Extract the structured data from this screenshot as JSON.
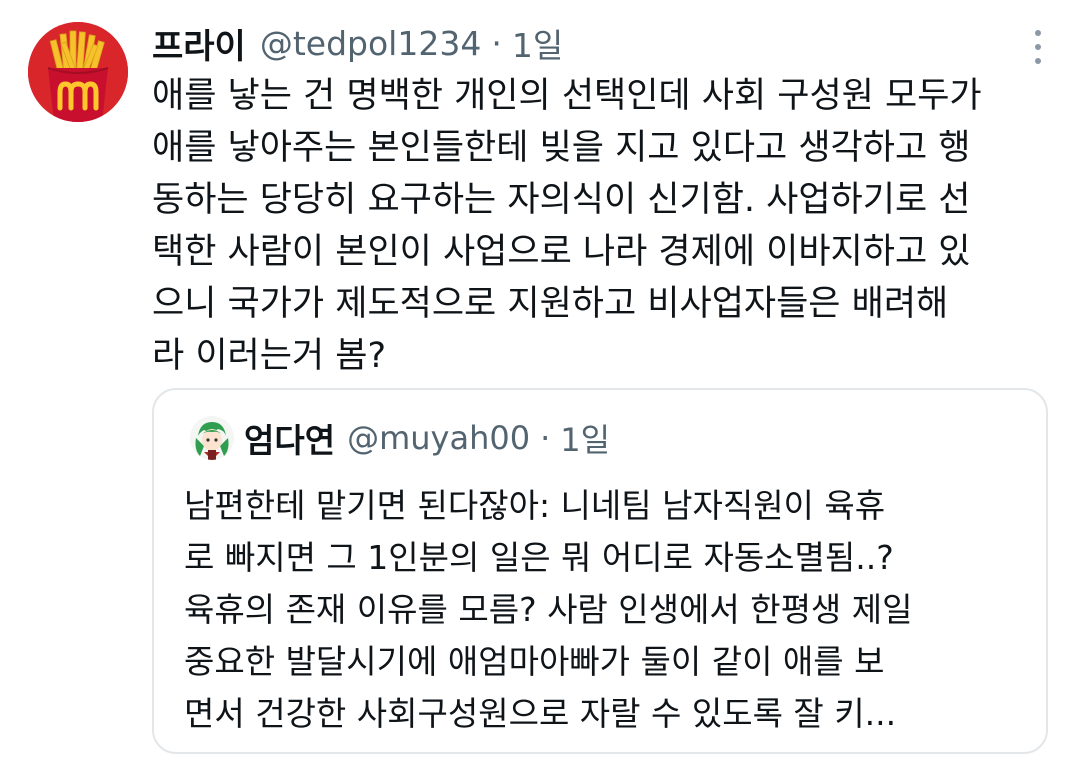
{
  "tweet": {
    "display_name": "프라이",
    "handle": "@tedpol1234",
    "separator": "·",
    "time": "1일",
    "avatar_icon": "mcdonalds-fries-icon",
    "text_lines": [
      "애를 낳는 건 명백한 개인의 선택인데 사회 구성원 모두가",
      "애를 낳아주는 본인들한테 빚을 지고 있다고 생각하고 행",
      "동하는 당당히 요구하는 자의식이 신기함. 사업하기로 선",
      "택한 사람이 본인이 사업으로 나라 경제에 이바지하고 있",
      "으니 국가가 제도적으로 지원하고 비사업자들은 배려해",
      "라 이러는거 봄?"
    ]
  },
  "quote": {
    "display_name": "엄다연",
    "handle": "@muyah00",
    "separator": "·",
    "time": "1일",
    "avatar_icon": "anime-character-avatar-icon",
    "text_lines": [
      "남편한테 맡기면 된다잖아: 니네팀 남자직원이 육휴",
      "로 빠지면 그 1인분의 일은 뭐 어디로 자동소멸됨..?",
      "육휴의 존재 이유를 모름? 사람 인생에서 한평생 제일",
      "중요한 발달시기에 애엄마아빠가 둘이 같이 애를 보",
      "면서 건강한 사회구성원으로 자랄 수 있도록 잘 키..."
    ]
  },
  "colors": {
    "text": "#0f1419",
    "secondary": "#536471",
    "border": "#e3e7ea",
    "avatar_red": "#d8262a",
    "fries_yellow": "#f6c12b"
  }
}
